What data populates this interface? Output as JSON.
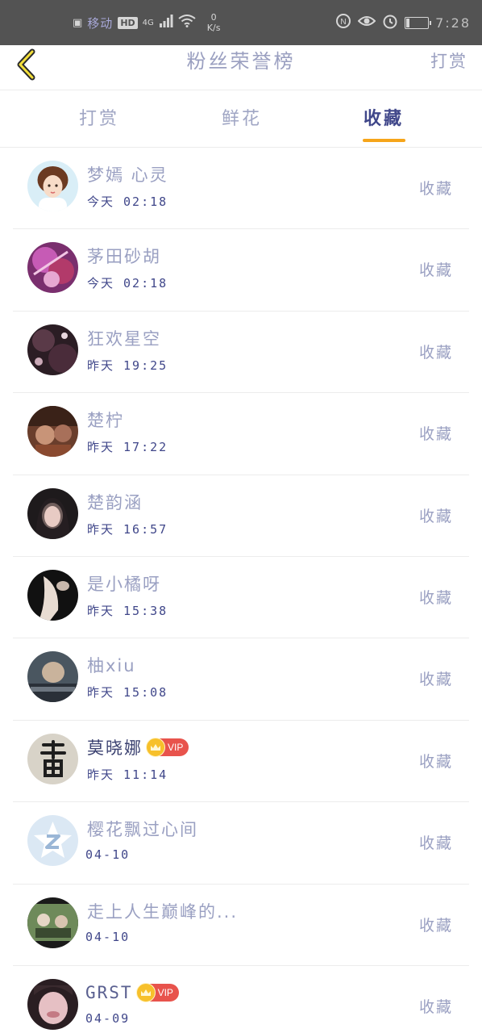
{
  "status_bar": {
    "carrier": "移动",
    "hd": "HD",
    "network": "4G",
    "speed_value": "0",
    "speed_unit": "K/s",
    "battery_level": 0.15,
    "time": "7:28"
  },
  "header": {
    "title": "粉丝荣誉榜",
    "action_label": "打赏"
  },
  "tabs": [
    {
      "label": "打赏",
      "active": false
    },
    {
      "label": "鲜花",
      "active": false
    },
    {
      "label": "收藏",
      "active": true
    }
  ],
  "colors": {
    "accent": "#f6a51a",
    "active_tab": "#40478a",
    "text_light": "#9aa0c2",
    "vip_red": "#e8534c",
    "vip_gold": "#f7c02b"
  },
  "fans": [
    {
      "name": "梦嫣 心灵",
      "time": "今天 02:18",
      "status": "收藏",
      "vip": false
    },
    {
      "name": "茅田砂胡",
      "time": "今天 02:18",
      "status": "收藏",
      "vip": false
    },
    {
      "name": "狂欢星空",
      "time": "昨天 19:25",
      "status": "收藏",
      "vip": false
    },
    {
      "name": "楚柠",
      "time": "昨天 17:22",
      "status": "收藏",
      "vip": false
    },
    {
      "name": "楚韵涵",
      "time": "昨天 16:57",
      "status": "收藏",
      "vip": false
    },
    {
      "name": "是小橘呀",
      "time": "昨天 15:38",
      "status": "收藏",
      "vip": false
    },
    {
      "name": "柚xiu",
      "time": "昨天 15:08",
      "status": "收藏",
      "vip": false
    },
    {
      "name": "莫晓娜",
      "time": "昨天 11:14",
      "status": "收藏",
      "vip": true,
      "vip_label": "VIP"
    },
    {
      "name": "樱花飘过心间",
      "time": "04-10",
      "status": "收藏",
      "vip": false
    },
    {
      "name": "走上人生巅峰的...",
      "time": "04-10",
      "status": "收藏",
      "vip": false
    },
    {
      "name": "GRST",
      "time": "04-09",
      "status": "收藏",
      "vip": true,
      "vip_label": "VIP"
    }
  ]
}
